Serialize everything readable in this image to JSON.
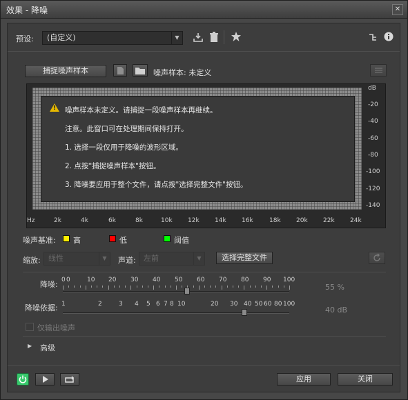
{
  "window": {
    "title": "效果 - 降噪",
    "close": "✕"
  },
  "preset": {
    "label": "预设:",
    "value": "(自定义)"
  },
  "capture": {
    "button": "捕捉噪声样本",
    "sample_label": "噪声样本: 未定义"
  },
  "message": {
    "line1": "噪声样本未定义。请捕捉一段噪声样本再继续。",
    "line2": "注意。此窗口可在处理期间保持打开。",
    "line3": "1. 选择一段仅用于降噪的波形区域。",
    "line4": "2. 点按\"捕捉噪声样本\"按钮。",
    "line5": "3. 降噪要应用于整个文件，请点按\"选择完整文件\"按钮。"
  },
  "graph": {
    "y_ticks": [
      "dB",
      "-20",
      "-40",
      "-60",
      "-80",
      "-100",
      "-120",
      "-140"
    ],
    "x_ticks": [
      "Hz",
      "2k",
      "4k",
      "6k",
      "8k",
      "10k",
      "12k",
      "14k",
      "16k",
      "18k",
      "20k",
      "22k",
      "24k"
    ]
  },
  "legend": {
    "label": "噪声基准:",
    "items": [
      {
        "name": "高",
        "color": "#ffee00"
      },
      {
        "name": "低",
        "color": "#ff0000"
      },
      {
        "name": "阈值",
        "color": "#00ff00"
      }
    ]
  },
  "controls": {
    "zoom_label": "缩放:",
    "zoom_value": "线性",
    "channel_label": "声道:",
    "channel_value": "左前",
    "select_full": "选择完整文件"
  },
  "reduction": {
    "label": "降噪:",
    "ticks": [
      "0",
      "0",
      "10",
      "20",
      "30",
      "40",
      "50",
      "60",
      "70",
      "80",
      "90",
      "100"
    ],
    "value_text": "55 %",
    "value": 55
  },
  "reduce_by": {
    "label": "降噪依据:",
    "ticks": [
      "1",
      "2",
      "3",
      "4",
      "5",
      "6",
      "7",
      "8",
      "10",
      "20",
      "30",
      "40",
      "50",
      "60",
      "80",
      "100"
    ],
    "value_text": "40 dB",
    "value": 40
  },
  "output_noise": {
    "label": "仅输出噪声"
  },
  "advanced": {
    "label": "高级"
  },
  "footer": {
    "apply": "应用",
    "close": "关闭"
  },
  "colors": {
    "power": "#38c86c"
  }
}
